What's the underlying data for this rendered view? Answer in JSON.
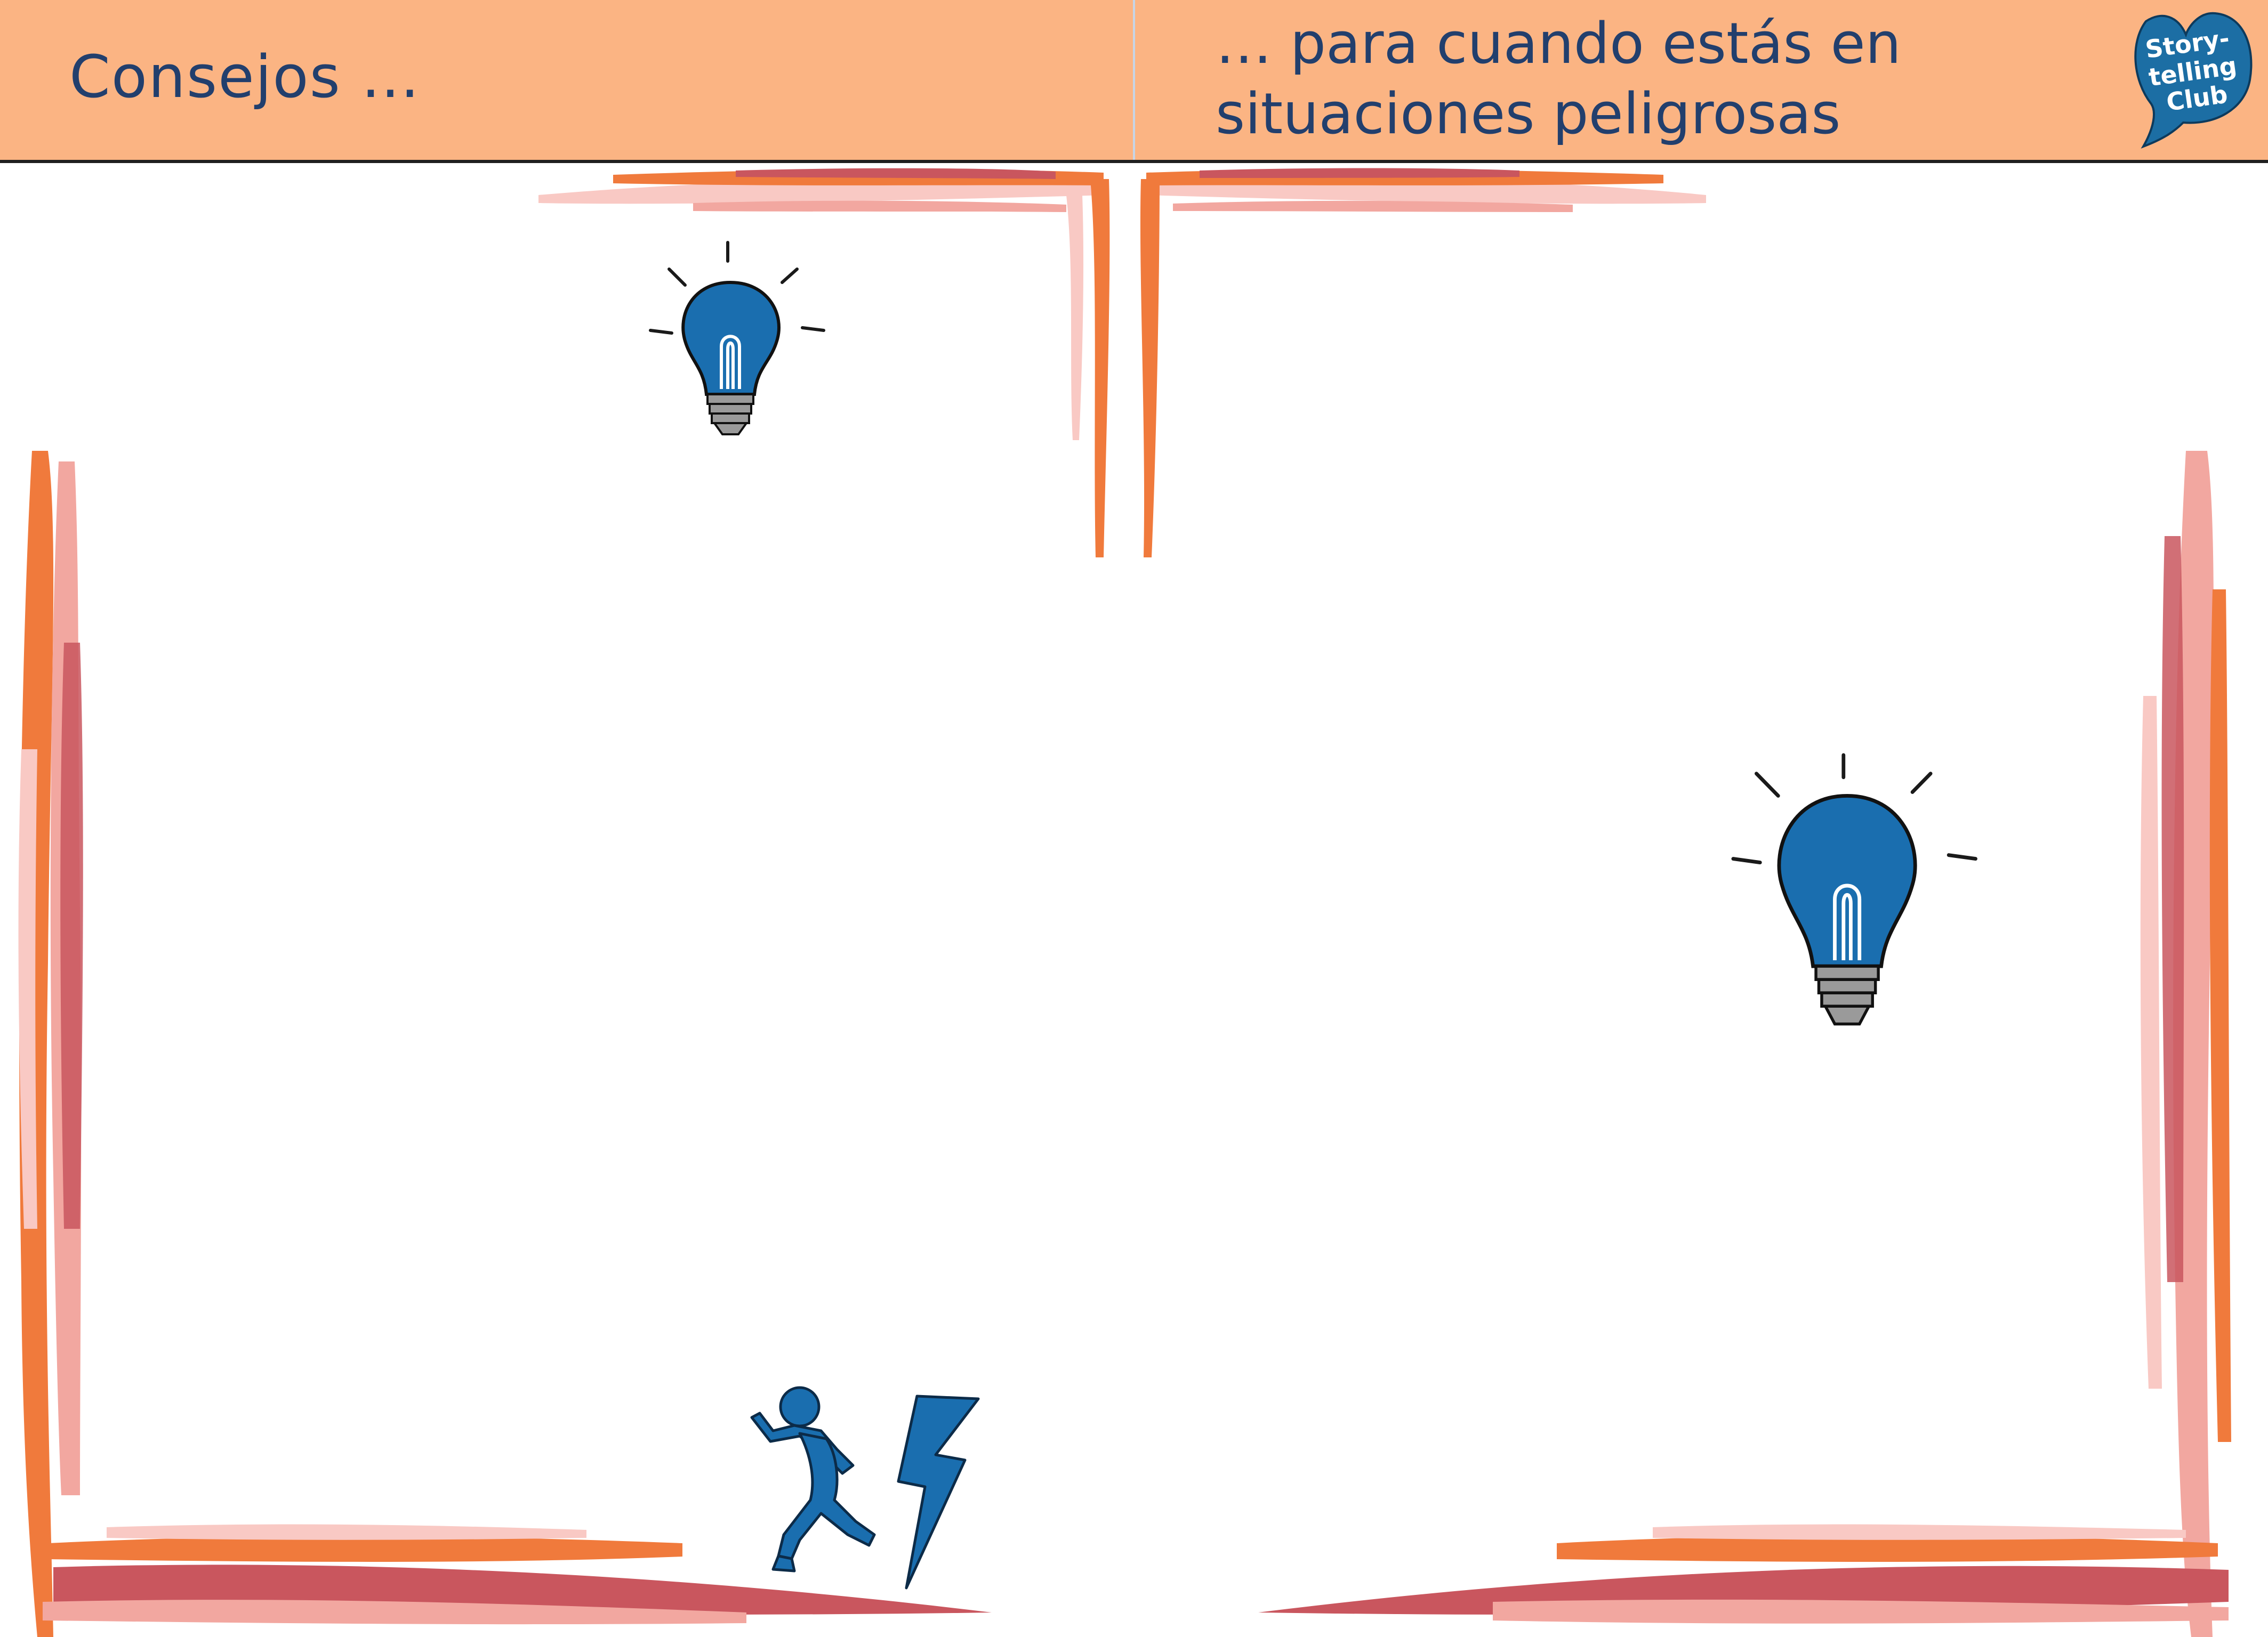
{
  "header": {
    "left_title": "Consejos …",
    "right_title": "… para cuando estás en situaciones peligrosas"
  },
  "logo": {
    "line1": "Story-",
    "line2": "telling",
    "line3": "Club"
  },
  "icons": {
    "bulb": "lightbulb-icon",
    "runner": "running-person-icon",
    "lightning": "lightning-bolt-icon"
  },
  "colors": {
    "header_bg": "#fbb483",
    "title_text": "#223f6d",
    "icon_blue": "#1a6eaf",
    "frame_orange": "#f07a3c",
    "frame_pink": "#f2a7a0",
    "frame_red": "#c9565e"
  }
}
